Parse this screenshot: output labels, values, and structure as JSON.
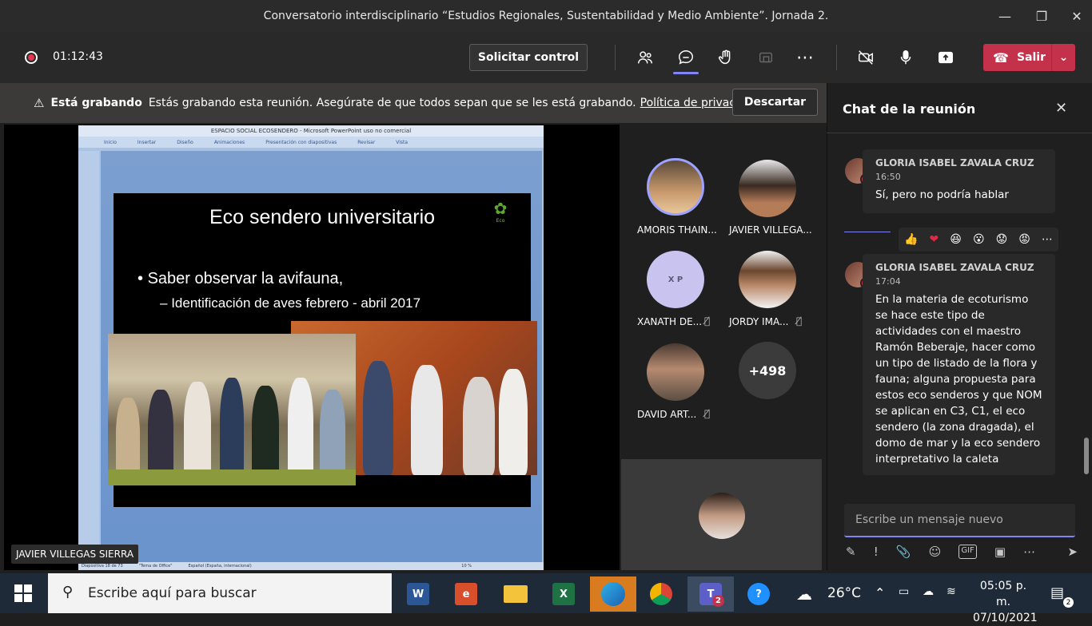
{
  "window": {
    "title": "Conversatorio interdisciplinario “Estudios Regionales, Sustentabilidad y Medio Ambiente”. Jornada 2."
  },
  "toolbar": {
    "timer": "01:12:43",
    "request_control": "Solicitar control",
    "leave": "Salir"
  },
  "banner": {
    "bold": "Está grabando",
    "text": "Estás grabando esta reunión. Asegúrate de que todos sepan que se les está grabando.",
    "link": "Política de privacidad",
    "dismiss": "Descartar"
  },
  "ppt": {
    "title": "ESPACIO SOCIAL ECOSENDERO - Microsoft PowerPoint uso no comercial",
    "tabs": [
      "Inicio",
      "Insertar",
      "Diseño",
      "Animaciones",
      "Presentación con diapositivas",
      "Revisar",
      "Vista"
    ],
    "status_slide": "Diapositiva 18 de 73",
    "status_theme": "\"Tema de Office\"",
    "status_lang": "Español (España, internacional)",
    "status_zoom": "10 %"
  },
  "slide": {
    "title": "Eco sendero universitario",
    "bullet": "Saber observar la avifauna,",
    "sub_bullet": "Identificación de aves febrero - abril 2017",
    "logo_text": "Eco"
  },
  "presenter": "JAVIER VILLEGAS SIERRA",
  "participants": [
    {
      "name": "AMORIS THAIN...",
      "muted": false
    },
    {
      "name": "JAVIER VILLEGA...",
      "muted": false
    },
    {
      "name": "XANATH DE...",
      "muted": true,
      "initials": "X P"
    },
    {
      "name": "JORDY IMA...",
      "muted": true
    },
    {
      "name": "DAVID ART...",
      "muted": true
    }
  ],
  "more_count": "+498",
  "chat": {
    "title": "Chat de la reunión",
    "messages": [
      {
        "author": "GLORIA ISABEL ZAVALA CRUZ",
        "time": "16:50",
        "text": "Sí, pero no podría hablar"
      },
      {
        "author": "GLORIA ISABEL ZAVALA CRUZ",
        "time": "17:04",
        "text": "En la materia de ecoturismo se hace este tipo de actividades con el maestro Ramón Beberaje, hacer como un tipo de listado de la flora y fauna; alguna propuesta para estos eco senderos y que NOM se aplican en C3, C1, el eco sendero (la zona dragada), el domo de mar y la eco sendero interpretativo la caleta"
      }
    ],
    "reactions": [
      "👍",
      "❤",
      "😆",
      "😮",
      "😟",
      "😡",
      "⋯"
    ],
    "compose_placeholder": "Escribe un mensaje nuevo"
  },
  "taskbar": {
    "search_placeholder": "Escribe aquí para buscar",
    "weather": "26°C",
    "time": "05:05 p. m.",
    "date": "07/10/2021",
    "teams_badge": "2",
    "notification_badge": "2"
  },
  "colors": {
    "accent": "#7f85f5",
    "leave": "#c4314b",
    "taskbar": "#1e2a38"
  }
}
